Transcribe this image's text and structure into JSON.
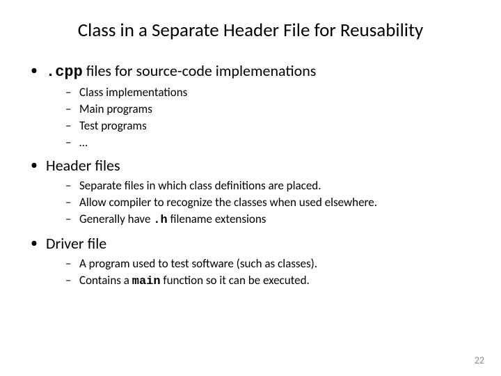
{
  "title": "Class in a Separate Header File for Reusability",
  "b1": {
    "p1": ".cpp",
    "p2": " files for source-code implemenations",
    "s1": "Class implementations",
    "s2": "Main programs",
    "s3": "Test programs",
    "s4": "…"
  },
  "b2": {
    "p1": "Header files",
    "s1": "Separate files in which class definitions are placed.",
    "s2": "Allow compiler to recognize the classes when used elsewhere.",
    "s3a": "Generally have ",
    "s3b": ".h",
    "s3c": " filename extensions"
  },
  "b3": {
    "p1": "Driver file",
    "s1": "A program used to test software (such as classes).",
    "s2a": "Contains a ",
    "s2b": "main",
    "s2c": " function so it can be executed."
  },
  "page": "22"
}
